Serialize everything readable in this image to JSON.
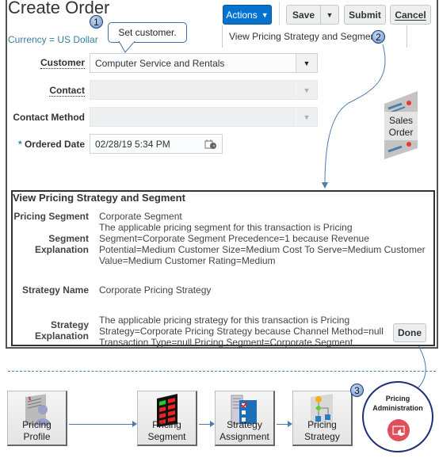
{
  "page": {
    "title": "Create Order",
    "currency": "Currency = US Dollar"
  },
  "toolbar": {
    "actions_label": "Actions",
    "save_label": "Save",
    "submit_label": "Submit",
    "cancel_label": "Cancel",
    "actions_menu_item": "View Pricing Strategy and Segment"
  },
  "callouts": {
    "step1_num": "1",
    "step1_text": "Set customer.",
    "step2_num": "2",
    "step3_num": "3"
  },
  "form": {
    "customer_label": "Customer",
    "customer_value": "Computer Service and Rentals",
    "contact_label": "Contact",
    "contact_value": "",
    "contact_method_label": "Contact Method",
    "contact_method_value": "",
    "ordered_date_required": "*",
    "ordered_date_label": "Ordered Date",
    "ordered_date_value": "02/28/19 5:34 PM"
  },
  "sales_order_icon": {
    "line1": "Sales",
    "line2": "Order"
  },
  "dialog": {
    "title": "View Pricing Strategy and Segment",
    "pricing_segment_label": "Pricing Segment",
    "pricing_segment_value": "Corporate Segment",
    "segment_explanation_label1": "Segment",
    "segment_explanation_label2": "Explanation",
    "segment_explanation_lines": [
      "The applicable pricing segment for this transaction is Pricing",
      "Segment=Corporate Segment Precedence=1 because Revenue",
      "Potential=Medium Customer Size=Medium Cost To Serve=Medium Customer",
      "Value=Medium Customer Rating=Medium"
    ],
    "strategy_name_label": "Strategy Name",
    "strategy_name_value": "Corporate Pricing Strategy",
    "strategy_explanation_label1": "Strategy",
    "strategy_explanation_label2": "Explanation",
    "strategy_explanation_lines": [
      "The applicable pricing strategy for this transaction is Pricing",
      "Strategy=Corporate Pricing Strategy because Channel Method=null",
      "Transaction Type=null Pricing Segment=Corporate Segment"
    ],
    "done_label": "Done"
  },
  "flow": {
    "tiles": [
      {
        "line1": "Pricing",
        "line2": "Profile"
      },
      {
        "line1": "Pricing",
        "line2": "Segment"
      },
      {
        "line1": "Strategy",
        "line2": "Assignment"
      },
      {
        "line1": "Pricing",
        "line2": "Strategy"
      }
    ],
    "admin_line1": "Pricing",
    "admin_line2": "Administration"
  },
  "colors": {
    "accent_blue": "#0572ce",
    "link_blue": "#3b7ea1",
    "connector_blue": "#4a7cb0",
    "admin_red": "#e0505a"
  }
}
